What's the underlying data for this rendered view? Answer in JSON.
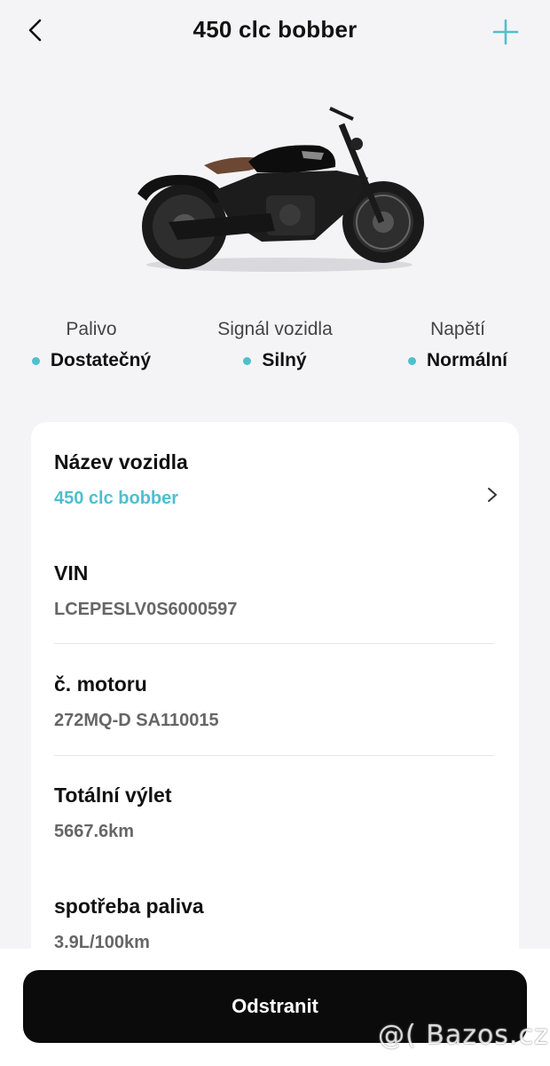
{
  "header": {
    "title": "450 clc bobber"
  },
  "status": [
    {
      "label": "Palivo",
      "value": "Dostatečný"
    },
    {
      "label": "Signál vozidla",
      "value": "Silný"
    },
    {
      "label": "Napětí",
      "value": "Normální"
    }
  ],
  "details": {
    "name_label": "Název vozidla",
    "name_value": "450 clc bobber",
    "vin_label": "VIN",
    "vin_value": "LCEPESLV0S6000597",
    "engine_label": "č. motoru",
    "engine_value": "272MQ-D SA110015",
    "trip_label": "Totální výlet",
    "trip_value": "5667.6km",
    "fuel_label": "spotřeba paliva",
    "fuel_value": "3.9L/100km"
  },
  "actions": {
    "remove_label": "Odstranit"
  },
  "watermark": "@( Bazos.cz",
  "colors": {
    "accent": "#4fbfcf",
    "background": "#f4f4f6",
    "button": "#0b0b0b"
  },
  "icons": {
    "back": "chevron-left-icon",
    "add": "plus-icon",
    "row": "chevron-right-icon"
  }
}
